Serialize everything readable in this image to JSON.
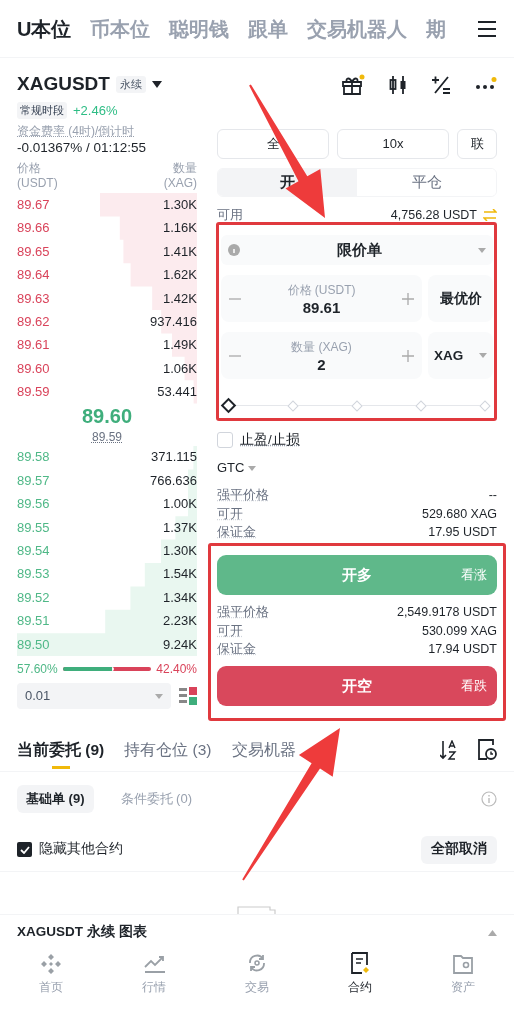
{
  "top_tabs": [
    {
      "label": "U本位",
      "selected": true
    },
    {
      "label": "币本位",
      "selected": false
    },
    {
      "label": "聪明钱",
      "selected": false
    },
    {
      "label": "跟单",
      "selected": false
    },
    {
      "label": "交易机器人",
      "selected": false
    },
    {
      "label": "期",
      "selected": false
    }
  ],
  "symbol": {
    "name": "XAGUSDT",
    "badge": "永续",
    "session": "常规时段",
    "change": "+2.46%"
  },
  "funding": {
    "label": "资金费率 (4时)/倒计时",
    "value": "-0.01367% / 01:12:55"
  },
  "orderbook": {
    "price_label": "价格",
    "price_unit": "(USDT)",
    "qty_label": "数量",
    "qty_unit": "(XAG)",
    "asks": [
      {
        "price": "89.67",
        "qty": "1.30K"
      },
      {
        "price": "89.66",
        "qty": "1.16K"
      },
      {
        "price": "89.65",
        "qty": "1.41K"
      },
      {
        "price": "89.64",
        "qty": "1.62K"
      },
      {
        "price": "89.63",
        "qty": "1.42K"
      },
      {
        "price": "89.62",
        "qty": "937.416"
      },
      {
        "price": "89.61",
        "qty": "1.49K"
      },
      {
        "price": "89.60",
        "qty": "1.06K"
      },
      {
        "price": "89.59",
        "qty": "53.441"
      }
    ],
    "last_price": "89.60",
    "mark_price": "89.59",
    "bids": [
      {
        "price": "89.58",
        "qty": "371.115"
      },
      {
        "price": "89.57",
        "qty": "766.636"
      },
      {
        "price": "89.56",
        "qty": "1.00K"
      },
      {
        "price": "89.55",
        "qty": "1.37K"
      },
      {
        "price": "89.54",
        "qty": "1.30K"
      },
      {
        "price": "89.53",
        "qty": "1.54K"
      },
      {
        "price": "89.52",
        "qty": "1.34K"
      },
      {
        "price": "89.51",
        "qty": "2.23K"
      },
      {
        "price": "89.50",
        "qty": "9.24K"
      }
    ],
    "ratio": {
      "buy": "57.60%",
      "sell": "42.40%",
      "level": 0.576
    },
    "precision": "0.01"
  },
  "order_form": {
    "margin_mode": "全",
    "leverage": "10x",
    "asset_mode": "联",
    "sides": [
      {
        "label": "开",
        "selected": true
      },
      {
        "label": "平仓",
        "selected": false
      }
    ],
    "available_label": "可用",
    "available": "4,756.28 USDT",
    "order_type": "限价单",
    "price": {
      "label": "价格 (USDT)",
      "value": "89.61"
    },
    "best_price": "最优价",
    "quantity": {
      "label": "数量 (XAG)",
      "value": "2"
    },
    "unit": "XAG",
    "slider": {
      "level": 0
    },
    "tp_sl": {
      "label": "止盈/止损",
      "checked": false
    },
    "tif": "GTC",
    "long_info": [
      {
        "label": "强平价格",
        "value": "--"
      },
      {
        "label": "可开",
        "value": "529.680 XAG"
      },
      {
        "label": "保证金",
        "value": "17.95 USDT"
      }
    ],
    "long_button": {
      "label": "开多",
      "hint": "看涨"
    },
    "short_info": [
      {
        "label": "强平价格",
        "value": "2,549.9178 USDT"
      },
      {
        "label": "可开",
        "value": "530.099 XAG"
      },
      {
        "label": "保证金",
        "value": "17.94 USDT"
      }
    ],
    "short_button": {
      "label": "开空",
      "hint": "看跌"
    }
  },
  "orders_tabs": [
    {
      "label": "当前委托 (9)",
      "selected": true
    },
    {
      "label": "持有仓位 (3)",
      "selected": false
    },
    {
      "label": "交易机器",
      "selected": false
    }
  ],
  "order_filters": [
    {
      "label": "基础单 (9)",
      "selected": true
    },
    {
      "label": "条件委托 (0)",
      "selected": false
    }
  ],
  "hide_other": {
    "label": "隐藏其他合约",
    "checked": true
  },
  "cancel_all": "全部取消",
  "chart_bar": {
    "label": "XAGUSDT 永续 图表"
  },
  "nav": [
    {
      "label": "首页",
      "kind": "home",
      "selected": false
    },
    {
      "label": "行情",
      "kind": "market",
      "selected": false
    },
    {
      "label": "交易",
      "kind": "trade",
      "selected": false
    },
    {
      "label": "合约",
      "kind": "futures",
      "selected": true
    },
    {
      "label": "资产",
      "kind": "assets",
      "selected": false
    }
  ]
}
